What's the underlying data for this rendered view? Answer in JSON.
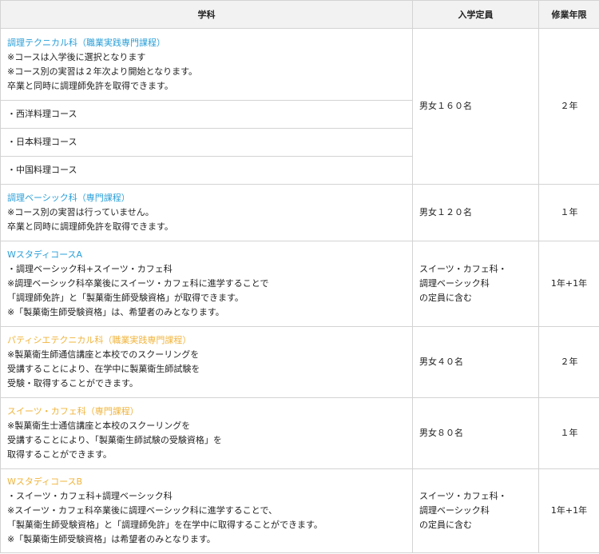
{
  "header": {
    "col_department": "学科",
    "col_capacity": "入学定員",
    "col_years": "修業年限"
  },
  "rows": [
    {
      "name": "調理テクニカル科（職業実践専門課程）",
      "lines": [
        "※コースは入学後に選択となります",
        "※コース別の実習は２年次より開始となります。",
        "卒業と同時に調理師免許を取得できます。"
      ],
      "courses": [
        "・西洋料理コース",
        "・日本料理コース",
        "・中国料理コース"
      ],
      "capacity": [
        "男女１６０名"
      ],
      "years": "２年"
    },
    {
      "name": "調理ベーシック科（専門課程）",
      "lines": [
        "※コース別の実習は行っていません。",
        "卒業と同時に調理師免許を取得できます。"
      ],
      "capacity": [
        "男女１２０名"
      ],
      "years": "１年"
    },
    {
      "name": "WスタディコースA",
      "lines": [
        "・調理ベーシック科+スイーツ・カフェ科",
        "※調理ベーシック科卒業後にスイーツ・カフェ科に進学することで",
        "「調理師免許」と「製菓衛生師受験資格」が取得できます。",
        "※「製菓衛生師受験資格」は、希望者のみとなります。"
      ],
      "capacity": [
        "スイーツ・カフェ科・",
        "調理ベーシック科",
        "の定員に含む"
      ],
      "years": "1年+1年"
    },
    {
      "name": "パティシエテクニカル科（職業実践専門課程）",
      "lines": [
        "※製菓衛生師通信講座と本校でのスクーリングを",
        "受講することにより、在学中に製菓衛生師試験を",
        "受験・取得することができます。"
      ],
      "capacity": [
        "男女４０名"
      ],
      "years": "２年"
    },
    {
      "name": "スイーツ・カフェ科（専門課程）",
      "lines": [
        "※製菓衛生士通信講座と本校のスクーリングを",
        "受講することにより、「製菓衛生師試験の受験資格」を",
        "取得することができます。"
      ],
      "capacity": [
        "男女８０名"
      ],
      "years": "１年"
    },
    {
      "name": "WスタディコースB",
      "lines": [
        "・スイーツ・カフェ科+調理ベーシック科",
        "※スイーツ・カフェ科卒業後に調理ベーシック科に進学することで、",
        "「製菓衛生師受験資格」と「調理師免許」を在学中に取得することができます。",
        "※「製菓衛生師受験資格」は希望者のみとなります。"
      ],
      "capacity": [
        "スイーツ・カフェ科・",
        "調理ベーシック科",
        "の定員に含む"
      ],
      "years": "1年+1年"
    }
  ],
  "colors": {
    "blue_dept": "#2a9fd8",
    "yellow_dept": "#f0b43c",
    "header_bg": "#f2f2f2",
    "border": "#d3d3d3"
  }
}
